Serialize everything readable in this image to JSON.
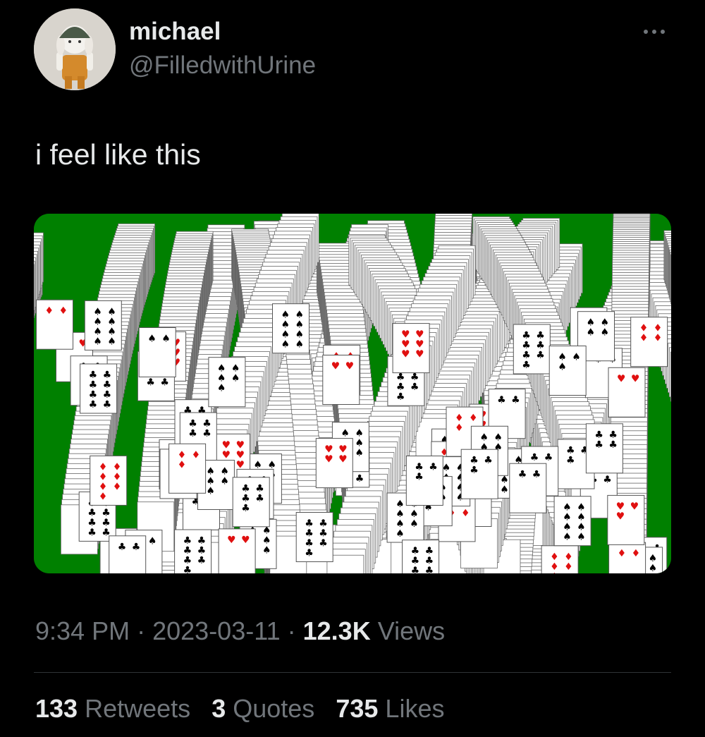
{
  "author": {
    "display_name": "michael",
    "handle": "@FilledwithUrine"
  },
  "more_icon": "more-horizontal-icon",
  "tweet": {
    "text": "i feel like this"
  },
  "media": {
    "description_icon": "solitaire-cascade-image"
  },
  "meta": {
    "time": "9:34 PM",
    "separator": "·",
    "date": "2023-03-11",
    "views_count": "12.3K",
    "views_label": "Views"
  },
  "stats": {
    "retweets_count": "133",
    "retweets_label": "Retweets",
    "quotes_count": "3",
    "quotes_label": "Quotes",
    "likes_count": "735",
    "likes_label": "Likes"
  },
  "colors": {
    "background": "#000000",
    "primary_text": "#e7e9ea",
    "secondary_text": "#71767b",
    "divider": "#2f3336",
    "felt_green": "#008000",
    "card_red": "#e01010"
  }
}
